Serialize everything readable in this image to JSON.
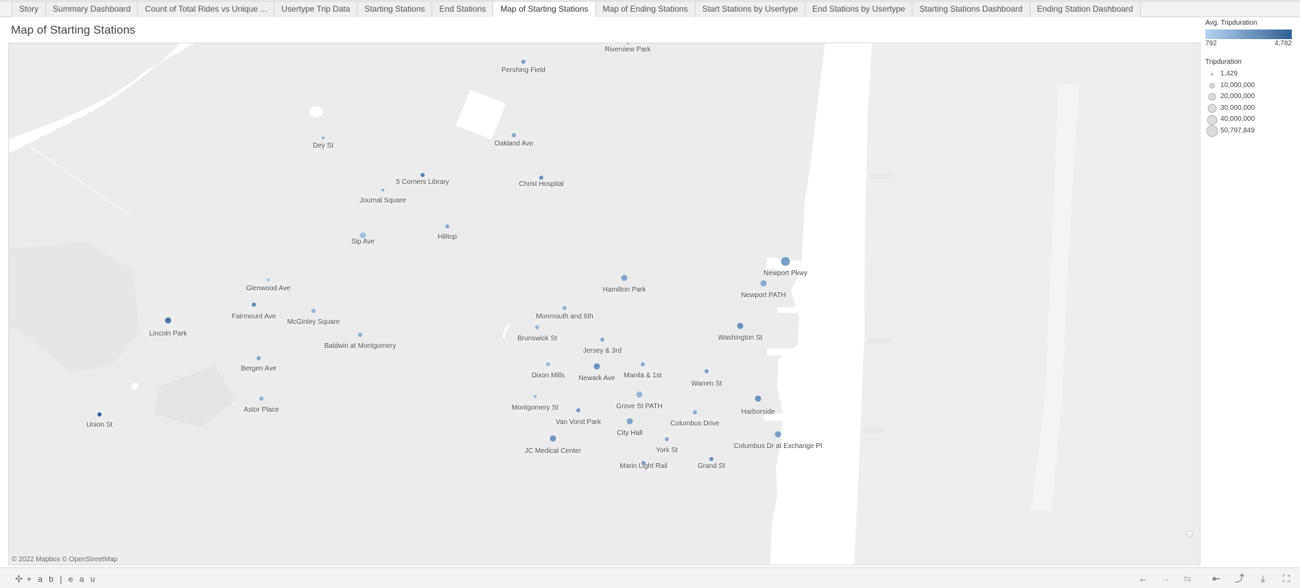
{
  "tabs": [
    {
      "label": "Story",
      "active": false
    },
    {
      "label": "Summary Dashboard",
      "active": false
    },
    {
      "label": "Count of Total Rides vs Unique ...",
      "active": false
    },
    {
      "label": "Usertype Trip Data",
      "active": false
    },
    {
      "label": "Starting Stations",
      "active": false
    },
    {
      "label": "End Stations",
      "active": false
    },
    {
      "label": "Map of Starting Stations",
      "active": true
    },
    {
      "label": "Map of Ending Stations",
      "active": false
    },
    {
      "label": "Start Stations by Usertype",
      "active": false
    },
    {
      "label": "End Stations by Usertype",
      "active": false
    },
    {
      "label": "Starting Stations Dashboard",
      "active": false
    },
    {
      "label": "Ending Station Dashboard",
      "active": false
    }
  ],
  "sheet_title": "Map of Starting Stations",
  "map": {
    "attribution": "© 2022 Mapbox © OpenStreetMap",
    "colors": {
      "land": "#ececec",
      "water": "#ffffff",
      "park": "#dfe3df",
      "low": "#b7d3ee",
      "high": "#2f5f94"
    }
  },
  "stations": [
    {
      "name": "Riverview Park",
      "level": 0.2,
      "tier": 0
    },
    {
      "name": "Pershing Field",
      "level": 0.45,
      "tier": 1
    },
    {
      "name": "Dey St",
      "level": 0.3,
      "tier": 0
    },
    {
      "name": "Oakland Ave",
      "level": 0.4,
      "tier": 1
    },
    {
      "name": "5 Corners Library",
      "level": 0.7,
      "tier": 1
    },
    {
      "name": "Christ Hospital",
      "level": 0.55,
      "tier": 1
    },
    {
      "name": "Journal Square",
      "level": 0.35,
      "tier": 0
    },
    {
      "name": "Sip Ave",
      "level": 0.15,
      "tier": 2
    },
    {
      "name": "Hilltop",
      "level": 0.3,
      "tier": 1
    },
    {
      "name": "Glenwood Ave",
      "level": 0.2,
      "tier": 0
    },
    {
      "name": "Fairmount Ave",
      "level": 0.65,
      "tier": 1
    },
    {
      "name": "McGinley Square",
      "level": 0.3,
      "tier": 1
    },
    {
      "name": "Lincoln Park",
      "level": 0.8,
      "tier": 2
    },
    {
      "name": "Baldwin at Montgomery",
      "level": 0.3,
      "tier": 1
    },
    {
      "name": "Bergen Ave",
      "level": 0.4,
      "tier": 1
    },
    {
      "name": "Astor Place",
      "level": 0.3,
      "tier": 1
    },
    {
      "name": "Union St",
      "level": 1.0,
      "tier": 1
    },
    {
      "name": "Hamilton Park",
      "level": 0.4,
      "tier": 2
    },
    {
      "name": "Newport Pkwy",
      "level": 0.45,
      "tier": 3
    },
    {
      "name": "Newport PATH",
      "level": 0.35,
      "tier": 2
    },
    {
      "name": "Monmouth and 6th",
      "level": 0.3,
      "tier": 1
    },
    {
      "name": "Brunswick St",
      "level": 0.25,
      "tier": 1
    },
    {
      "name": "Jersey & 3rd",
      "level": 0.35,
      "tier": 1
    },
    {
      "name": "Washington St",
      "level": 0.55,
      "tier": 2
    },
    {
      "name": "Dixon Mills",
      "level": 0.2,
      "tier": 1
    },
    {
      "name": "Newark Ave",
      "level": 0.55,
      "tier": 2
    },
    {
      "name": "Manila & 1st",
      "level": 0.35,
      "tier": 1
    },
    {
      "name": "Warren St",
      "level": 0.45,
      "tier": 1
    },
    {
      "name": "Montgomery St",
      "level": 0.25,
      "tier": 0
    },
    {
      "name": "Grove St PATH",
      "level": 0.25,
      "tier": 2
    },
    {
      "name": "Harborside",
      "level": 0.55,
      "tier": 2
    },
    {
      "name": "Van Vorst Park",
      "level": 0.5,
      "tier": 1
    },
    {
      "name": "Columbus Drive",
      "level": 0.35,
      "tier": 1
    },
    {
      "name": "City Hall",
      "level": 0.4,
      "tier": 2
    },
    {
      "name": "JC Medical Center",
      "level": 0.55,
      "tier": 2
    },
    {
      "name": "York St",
      "level": 0.35,
      "tier": 1
    },
    {
      "name": "Columbus Dr at Exchange Pl",
      "level": 0.45,
      "tier": 2
    },
    {
      "name": "Marin Light Rail",
      "level": 0.6,
      "tier": 1
    },
    {
      "name": "Grand St",
      "level": 0.55,
      "tier": 1
    }
  ],
  "legend": {
    "color": {
      "title": "Avg. Tripduration",
      "min": "792",
      "max": "4,782"
    },
    "size": {
      "title": "Tripduration",
      "items": [
        "1,429",
        "10,000,000",
        "20,000,000",
        "30,000,000",
        "40,000,000",
        "50,797,849"
      ]
    }
  },
  "toolbar": {
    "brand": "+ a b | e a u",
    "icons": [
      "undo-icon",
      "redo-icon",
      "revert-icon",
      "pause-icon",
      "share-icon",
      "download-icon",
      "fullscreen-icon"
    ]
  }
}
